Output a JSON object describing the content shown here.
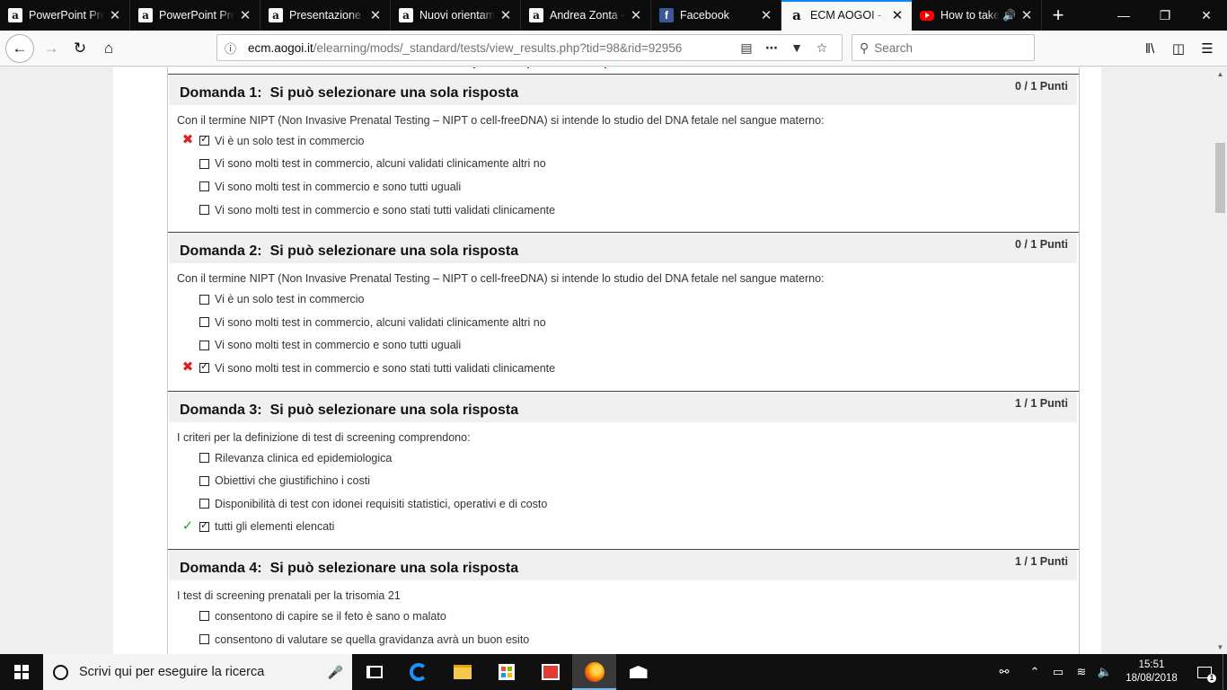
{
  "tabs": [
    {
      "title": "PowerPoint Pres",
      "icon": "aogoi-favicon"
    },
    {
      "title": "PowerPoint Pres",
      "icon": "aogoi-favicon"
    },
    {
      "title": "Presentazione st",
      "icon": "aogoi-favicon"
    },
    {
      "title": "Nuovi orientam",
      "icon": "aogoi-favicon"
    },
    {
      "title": "Andrea Zonta -",
      "icon": "aogoi-favicon"
    },
    {
      "title": "Facebook",
      "icon": "facebook-favicon"
    },
    {
      "title": "ECM AOGOI - Il",
      "icon": "aogoi-favicon",
      "active": true
    },
    {
      "title": "How to take",
      "icon": "youtube-favicon",
      "audio": true
    }
  ],
  "urlbar": {
    "host": "ecm.aogoi.it",
    "path": "/elearning/mods/_standard/tests/view_results.php?tid=98&rid=92956"
  },
  "search": {
    "placeholder": "Search"
  },
  "questions": [
    {
      "number": "Domanda 1:",
      "type": "Si può selezionare una sola risposta",
      "score": "0 / 1 Punti",
      "text": "Con il termine NIPT (Non Invasive Prenatal Testing – NIPT o cell-freeDNA) si intende lo studio del DNA fetale nel sangue materno:",
      "answers": [
        {
          "label": "Vi è un solo test in commercio",
          "checked": true,
          "mark": "wrong"
        },
        {
          "label": "Vi sono molti test in commercio, alcuni validati clinicamente altri no",
          "checked": false,
          "mark": ""
        },
        {
          "label": "Vi sono molti test in commercio e sono tutti uguali",
          "checked": false,
          "mark": ""
        },
        {
          "label": "Vi sono molti test in commercio e sono stati tutti validati clinicamente",
          "checked": false,
          "mark": ""
        }
      ]
    },
    {
      "number": "Domanda 2:",
      "type": "Si può selezionare una sola risposta",
      "score": "0 / 1 Punti",
      "text": "Con il termine NIPT (Non Invasive Prenatal Testing – NIPT o cell-freeDNA) si intende lo studio del DNA fetale nel sangue materno:",
      "answers": [
        {
          "label": "Vi è un solo test in commercio",
          "checked": false,
          "mark": ""
        },
        {
          "label": "Vi sono molti test in commercio, alcuni validati clinicamente altri no",
          "checked": false,
          "mark": ""
        },
        {
          "label": "Vi sono molti test in commercio e sono tutti uguali",
          "checked": false,
          "mark": ""
        },
        {
          "label": "Vi sono molti test in commercio e sono stati tutti validati clinicamente",
          "checked": true,
          "mark": "wrong"
        }
      ]
    },
    {
      "number": "Domanda 3:",
      "type": "Si può selezionare una sola risposta",
      "score": "1 / 1 Punti",
      "text": "I criteri per la definizione di test di screening comprendono:",
      "answers": [
        {
          "label": "Rilevanza clinica ed epidemiologica",
          "checked": false,
          "mark": ""
        },
        {
          "label": "Obiettivi che giustifichino i costi",
          "checked": false,
          "mark": ""
        },
        {
          "label": "Disponibilità di test con idonei requisiti statistici, operativi e di costo",
          "checked": false,
          "mark": ""
        },
        {
          "label": "tutti gli elementi elencati",
          "checked": true,
          "mark": "right"
        }
      ]
    },
    {
      "number": "Domanda 4:",
      "type": "Si può selezionare una sola risposta",
      "score": "1 / 1 Punti",
      "text": "I test di screening prenatali per la trisomia 21",
      "answers": [
        {
          "label": "consentono di capire se il feto è sano o malato",
          "checked": false,
          "mark": ""
        },
        {
          "label": "consentono di valutare se quella gravidanza avrà un buon esito",
          "checked": false,
          "mark": ""
        }
      ]
    }
  ],
  "taskbar": {
    "search_placeholder": "Scrivi qui per eseguire la ricerca",
    "time": "15:51",
    "date": "18/08/2018",
    "notification_count": "1"
  },
  "colors": {
    "wrong": "#e02020",
    "right": "#2e9a2e",
    "accent": "#0a84ff"
  }
}
